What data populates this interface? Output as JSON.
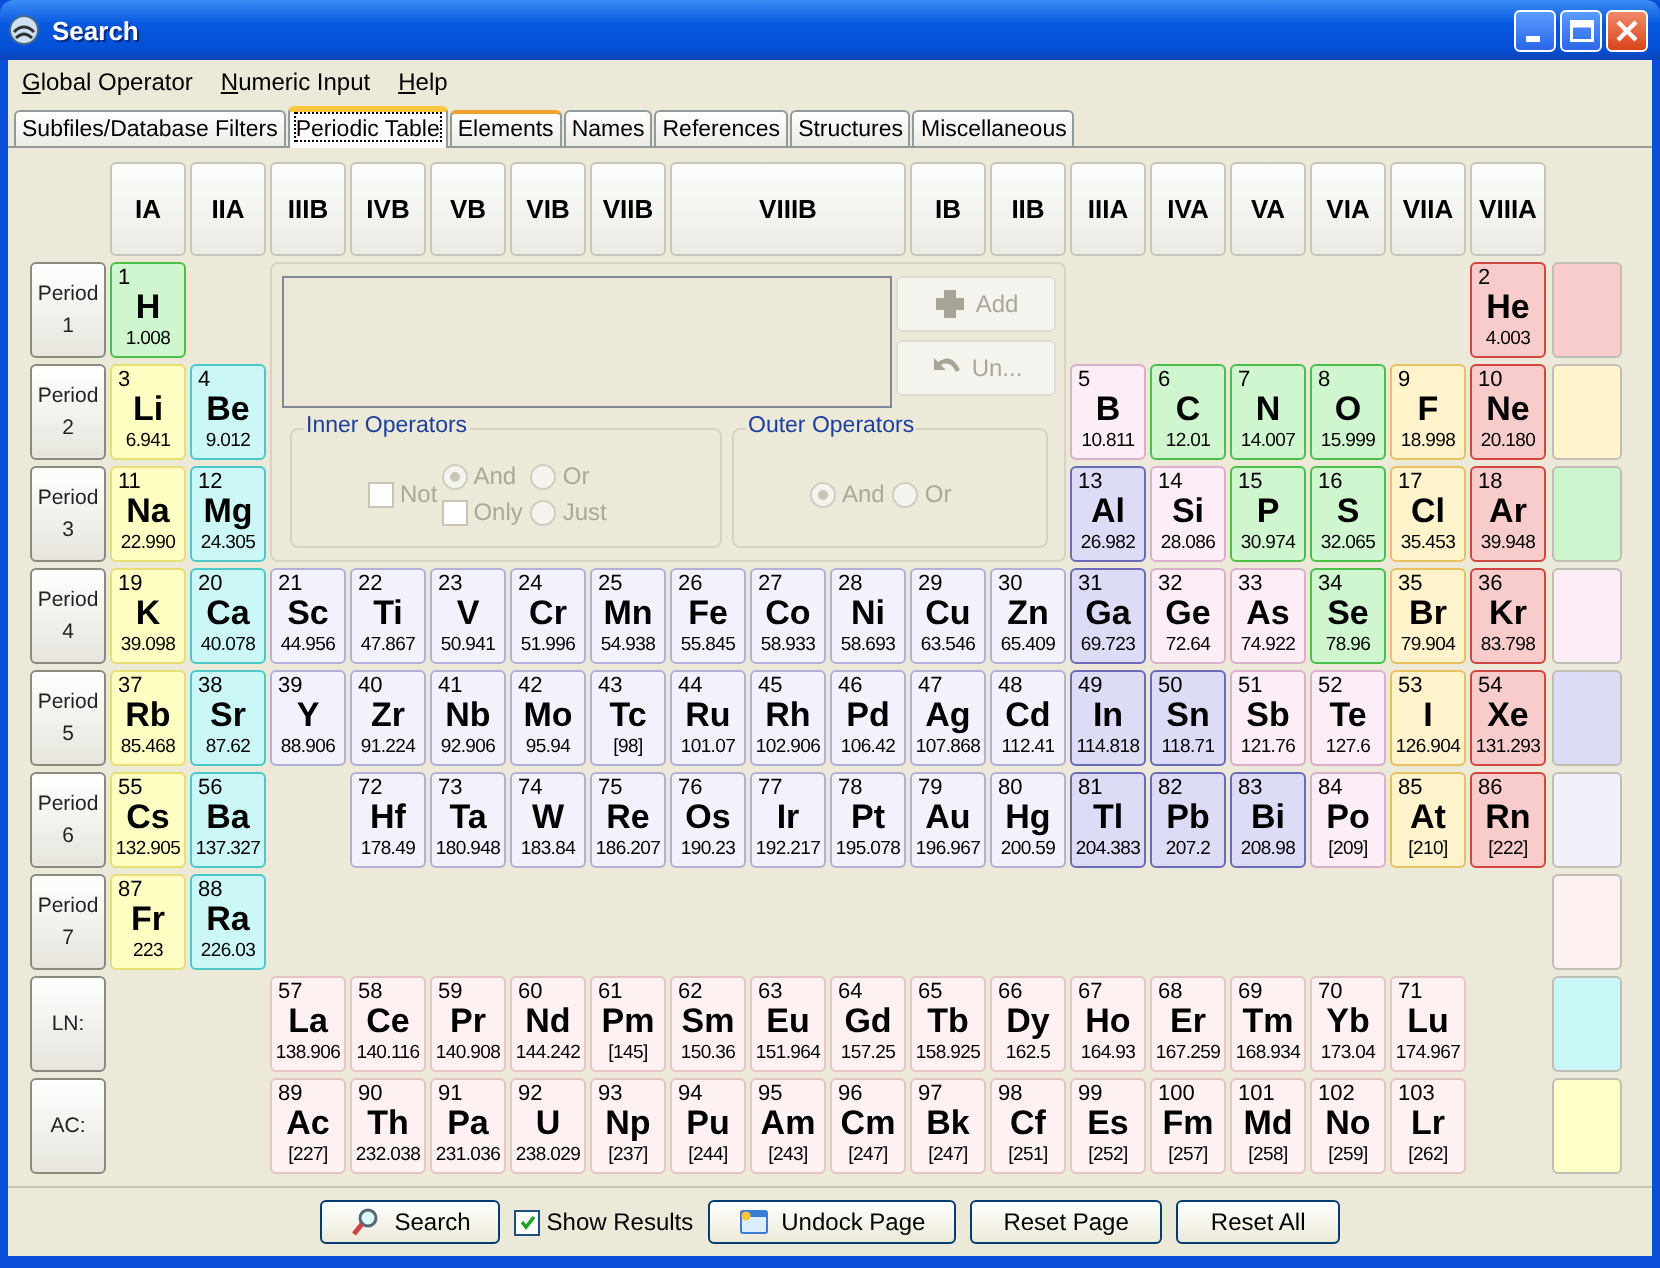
{
  "window": {
    "title": "Search"
  },
  "menu": [
    {
      "label": "Global Operator"
    },
    {
      "label": "Numeric Input"
    },
    {
      "label": "Help"
    }
  ],
  "tabs": [
    {
      "label": "Subfiles/Database Filters",
      "selected": false,
      "hot": false
    },
    {
      "label": "Periodic Table",
      "selected": true,
      "hot": false
    },
    {
      "label": "Elements",
      "selected": false,
      "hot": true
    },
    {
      "label": "Names",
      "selected": false,
      "hot": false
    },
    {
      "label": "References",
      "selected": false,
      "hot": false
    },
    {
      "label": "Structures",
      "selected": false,
      "hot": false
    },
    {
      "label": "Miscellaneous",
      "selected": false,
      "hot": false
    }
  ],
  "group_headers": [
    {
      "label": "IA",
      "wide": false
    },
    {
      "label": "IIA",
      "wide": false
    },
    {
      "label": "IIIB",
      "wide": false
    },
    {
      "label": "IVB",
      "wide": false
    },
    {
      "label": "VB",
      "wide": false
    },
    {
      "label": "VIB",
      "wide": false
    },
    {
      "label": "VIIB",
      "wide": false
    },
    {
      "label": "VIIIB",
      "wide": true
    },
    {
      "label": "IB",
      "wide": false
    },
    {
      "label": "IIB",
      "wide": false
    },
    {
      "label": "IIIA",
      "wide": false
    },
    {
      "label": "IVA",
      "wide": false
    },
    {
      "label": "VA",
      "wide": false
    },
    {
      "label": "VIA",
      "wide": false
    },
    {
      "label": "VIIA",
      "wide": false
    },
    {
      "label": "VIIIA",
      "wide": false
    }
  ],
  "periods": [
    {
      "label": "Period 1",
      "left": [
        {
          "number": "1",
          "symbol": "H",
          "mass": "1.008",
          "kind": "nonmetal"
        }
      ],
      "right": [
        {
          "number": "2",
          "symbol": "He",
          "mass": "4.003",
          "kind": "noble"
        }
      ]
    },
    {
      "label": "Period 2",
      "left": [
        {
          "number": "3",
          "symbol": "Li",
          "mass": "6.941",
          "kind": "alkali"
        },
        {
          "number": "4",
          "symbol": "Be",
          "mass": "9.012",
          "kind": "alkaline"
        }
      ],
      "right": [
        {
          "number": "5",
          "symbol": "B",
          "mass": "10.811",
          "kind": "metalloid"
        },
        {
          "number": "6",
          "symbol": "C",
          "mass": "12.01",
          "kind": "nonmetal"
        },
        {
          "number": "7",
          "symbol": "N",
          "mass": "14.007",
          "kind": "nonmetal"
        },
        {
          "number": "8",
          "symbol": "O",
          "mass": "15.999",
          "kind": "nonmetal"
        },
        {
          "number": "9",
          "symbol": "F",
          "mass": "18.998",
          "kind": "halogen"
        },
        {
          "number": "10",
          "symbol": "Ne",
          "mass": "20.180",
          "kind": "noble"
        }
      ]
    },
    {
      "label": "Period 3",
      "left": [
        {
          "number": "11",
          "symbol": "Na",
          "mass": "22.990",
          "kind": "alkali"
        },
        {
          "number": "12",
          "symbol": "Mg",
          "mass": "24.305",
          "kind": "alkaline"
        }
      ],
      "right": [
        {
          "number": "13",
          "symbol": "Al",
          "mass": "26.982",
          "kind": "post"
        },
        {
          "number": "14",
          "symbol": "Si",
          "mass": "28.086",
          "kind": "metalloid"
        },
        {
          "number": "15",
          "symbol": "P",
          "mass": "30.974",
          "kind": "nonmetal"
        },
        {
          "number": "16",
          "symbol": "S",
          "mass": "32.065",
          "kind": "nonmetal"
        },
        {
          "number": "17",
          "symbol": "Cl",
          "mass": "35.453",
          "kind": "halogen"
        },
        {
          "number": "18",
          "symbol": "Ar",
          "mass": "39.948",
          "kind": "noble"
        }
      ]
    },
    {
      "label": "Period 4",
      "left": [
        {
          "number": "19",
          "symbol": "K",
          "mass": "39.098",
          "kind": "alkali"
        },
        {
          "number": "20",
          "symbol": "Ca",
          "mass": "40.078",
          "kind": "alkaline"
        }
      ],
      "right": [
        {
          "number": "21",
          "symbol": "Sc",
          "mass": "44.956",
          "kind": "transition"
        },
        {
          "number": "22",
          "symbol": "Ti",
          "mass": "47.867",
          "kind": "transition"
        },
        {
          "number": "23",
          "symbol": "V",
          "mass": "50.941",
          "kind": "transition"
        },
        {
          "number": "24",
          "symbol": "Cr",
          "mass": "51.996",
          "kind": "transition"
        },
        {
          "number": "25",
          "symbol": "Mn",
          "mass": "54.938",
          "kind": "transition"
        },
        {
          "number": "26",
          "symbol": "Fe",
          "mass": "55.845",
          "kind": "transition"
        },
        {
          "number": "27",
          "symbol": "Co",
          "mass": "58.933",
          "kind": "transition"
        },
        {
          "number": "28",
          "symbol": "Ni",
          "mass": "58.693",
          "kind": "transition"
        },
        {
          "number": "29",
          "symbol": "Cu",
          "mass": "63.546",
          "kind": "transition"
        },
        {
          "number": "30",
          "symbol": "Zn",
          "mass": "65.409",
          "kind": "transition"
        },
        {
          "number": "31",
          "symbol": "Ga",
          "mass": "69.723",
          "kind": "post"
        },
        {
          "number": "32",
          "symbol": "Ge",
          "mass": "72.64",
          "kind": "metalloid"
        },
        {
          "number": "33",
          "symbol": "As",
          "mass": "74.922",
          "kind": "metalloid"
        },
        {
          "number": "34",
          "symbol": "Se",
          "mass": "78.96",
          "kind": "nonmetal"
        },
        {
          "number": "35",
          "symbol": "Br",
          "mass": "79.904",
          "kind": "halogen"
        },
        {
          "number": "36",
          "symbol": "Kr",
          "mass": "83.798",
          "kind": "noble"
        }
      ]
    },
    {
      "label": "Period 5",
      "left": [
        {
          "number": "37",
          "symbol": "Rb",
          "mass": "85.468",
          "kind": "alkali"
        },
        {
          "number": "38",
          "symbol": "Sr",
          "mass": "87.62",
          "kind": "alkaline"
        }
      ],
      "right": [
        {
          "number": "39",
          "symbol": "Y",
          "mass": "88.906",
          "kind": "transition"
        },
        {
          "number": "40",
          "symbol": "Zr",
          "mass": "91.224",
          "kind": "transition"
        },
        {
          "number": "41",
          "symbol": "Nb",
          "mass": "92.906",
          "kind": "transition"
        },
        {
          "number": "42",
          "symbol": "Mo",
          "mass": "95.94",
          "kind": "transition"
        },
        {
          "number": "43",
          "symbol": "Tc",
          "mass": "[98]",
          "kind": "transition"
        },
        {
          "number": "44",
          "symbol": "Ru",
          "mass": "101.07",
          "kind": "transition"
        },
        {
          "number": "45",
          "symbol": "Rh",
          "mass": "102.906",
          "kind": "transition"
        },
        {
          "number": "46",
          "symbol": "Pd",
          "mass": "106.42",
          "kind": "transition"
        },
        {
          "number": "47",
          "symbol": "Ag",
          "mass": "107.868",
          "kind": "transition"
        },
        {
          "number": "48",
          "symbol": "Cd",
          "mass": "112.41",
          "kind": "transition"
        },
        {
          "number": "49",
          "symbol": "In",
          "mass": "114.818",
          "kind": "post"
        },
        {
          "number": "50",
          "symbol": "Sn",
          "mass": "118.71",
          "kind": "post"
        },
        {
          "number": "51",
          "symbol": "Sb",
          "mass": "121.76",
          "kind": "metalloid"
        },
        {
          "number": "52",
          "symbol": "Te",
          "mass": "127.6",
          "kind": "metalloid"
        },
        {
          "number": "53",
          "symbol": "I",
          "mass": "126.904",
          "kind": "halogen"
        },
        {
          "number": "54",
          "symbol": "Xe",
          "mass": "131.293",
          "kind": "noble"
        }
      ]
    },
    {
      "label": "Period 6",
      "left": [
        {
          "number": "55",
          "symbol": "Cs",
          "mass": "132.905",
          "kind": "alkali"
        },
        {
          "number": "56",
          "symbol": "Ba",
          "mass": "137.327",
          "kind": "alkaline"
        }
      ],
      "right": [
        {
          "number": "72",
          "symbol": "Hf",
          "mass": "178.49",
          "kind": "transition"
        },
        {
          "number": "73",
          "symbol": "Ta",
          "mass": "180.948",
          "kind": "transition"
        },
        {
          "number": "74",
          "symbol": "W",
          "mass": "183.84",
          "kind": "transition"
        },
        {
          "number": "75",
          "symbol": "Re",
          "mass": "186.207",
          "kind": "transition"
        },
        {
          "number": "76",
          "symbol": "Os",
          "mass": "190.23",
          "kind": "transition"
        },
        {
          "number": "77",
          "symbol": "Ir",
          "mass": "192.217",
          "kind": "transition"
        },
        {
          "number": "78",
          "symbol": "Pt",
          "mass": "195.078",
          "kind": "transition"
        },
        {
          "number": "79",
          "symbol": "Au",
          "mass": "196.967",
          "kind": "transition"
        },
        {
          "number": "80",
          "symbol": "Hg",
          "mass": "200.59",
          "kind": "transition"
        },
        {
          "number": "81",
          "symbol": "Tl",
          "mass": "204.383",
          "kind": "post"
        },
        {
          "number": "82",
          "symbol": "Pb",
          "mass": "207.2",
          "kind": "post"
        },
        {
          "number": "83",
          "symbol": "Bi",
          "mass": "208.98",
          "kind": "post"
        },
        {
          "number": "84",
          "symbol": "Po",
          "mass": "[209]",
          "kind": "metalloid"
        },
        {
          "number": "85",
          "symbol": "At",
          "mass": "[210]",
          "kind": "halogen"
        },
        {
          "number": "86",
          "symbol": "Rn",
          "mass": "[222]",
          "kind": "noble"
        }
      ]
    },
    {
      "label": "Period 7",
      "left": [
        {
          "number": "87",
          "symbol": "Fr",
          "mass": "223",
          "kind": "alkali"
        },
        {
          "number": "88",
          "symbol": "Ra",
          "mass": "226.03",
          "kind": "alkaline"
        }
      ]
    }
  ],
  "series": [
    {
      "label": "LN:",
      "elements": [
        {
          "number": "57",
          "symbol": "La",
          "mass": "138.906"
        },
        {
          "number": "58",
          "symbol": "Ce",
          "mass": "140.116"
        },
        {
          "number": "59",
          "symbol": "Pr",
          "mass": "140.908"
        },
        {
          "number": "60",
          "symbol": "Nd",
          "mass": "144.242"
        },
        {
          "number": "61",
          "symbol": "Pm",
          "mass": "[145]"
        },
        {
          "number": "62",
          "symbol": "Sm",
          "mass": "150.36"
        },
        {
          "number": "63",
          "symbol": "Eu",
          "mass": "151.964"
        },
        {
          "number": "64",
          "symbol": "Gd",
          "mass": "157.25"
        },
        {
          "number": "65",
          "symbol": "Tb",
          "mass": "158.925"
        },
        {
          "number": "66",
          "symbol": "Dy",
          "mass": "162.5"
        },
        {
          "number": "67",
          "symbol": "Ho",
          "mass": "164.93"
        },
        {
          "number": "68",
          "symbol": "Er",
          "mass": "167.259"
        },
        {
          "number": "69",
          "symbol": "Tm",
          "mass": "168.934"
        },
        {
          "number": "70",
          "symbol": "Yb",
          "mass": "173.04"
        },
        {
          "number": "71",
          "symbol": "Lu",
          "mass": "174.967"
        }
      ]
    },
    {
      "label": "AC:",
      "elements": [
        {
          "number": "89",
          "symbol": "Ac",
          "mass": "[227]"
        },
        {
          "number": "90",
          "symbol": "Th",
          "mass": "232.038"
        },
        {
          "number": "91",
          "symbol": "Pa",
          "mass": "231.036"
        },
        {
          "number": "92",
          "symbol": "U",
          "mass": "238.029"
        },
        {
          "number": "93",
          "symbol": "Np",
          "mass": "[237]"
        },
        {
          "number": "94",
          "symbol": "Pu",
          "mass": "[244]"
        },
        {
          "number": "95",
          "symbol": "Am",
          "mass": "[243]"
        },
        {
          "number": "96",
          "symbol": "Cm",
          "mass": "[247]"
        },
        {
          "number": "97",
          "symbol": "Bk",
          "mass": "[247]"
        },
        {
          "number": "98",
          "symbol": "Cf",
          "mass": "[251]"
        },
        {
          "number": "99",
          "symbol": "Es",
          "mass": "[252]"
        },
        {
          "number": "100",
          "symbol": "Fm",
          "mass": "[257]"
        },
        {
          "number": "101",
          "symbol": "Md",
          "mass": "[258]"
        },
        {
          "number": "102",
          "symbol": "No",
          "mass": "[259]"
        },
        {
          "number": "103",
          "symbol": "Lr",
          "mass": "[262]"
        }
      ]
    }
  ],
  "legend": [
    {
      "color": "#f9cccc"
    },
    {
      "color": "#fff3cc"
    },
    {
      "color": "#cdf5cd"
    },
    {
      "color": "#fcecf6"
    },
    {
      "color": "#dcdcf6"
    },
    {
      "color": "#f0f0fb"
    },
    {
      "color": "#fcf0f0"
    },
    {
      "color": "#c9f6f6"
    },
    {
      "color": "#ffffc8"
    }
  ],
  "operators": {
    "disabled": true,
    "add_button": "Add",
    "undo_button": "Un...",
    "inner": {
      "title": "Inner Operators",
      "not": {
        "label": "Not",
        "checked": false
      },
      "options": [
        {
          "kind": "radio",
          "label": "And",
          "selected": true
        },
        {
          "kind": "radio",
          "label": "Or",
          "selected": false
        },
        {
          "kind": "checkbox",
          "label": "Only",
          "checked": false
        },
        {
          "kind": "radio",
          "label": "Just",
          "selected": false
        }
      ]
    },
    "outer": {
      "title": "Outer Operators",
      "options": [
        {
          "kind": "radio",
          "label": "And",
          "selected": true
        },
        {
          "kind": "radio",
          "label": "Or",
          "selected": false
        }
      ]
    }
  },
  "bottom": {
    "search_button": "Search",
    "show_results": {
      "label": "Show Results",
      "checked": true
    },
    "undock_button": "Undock Page",
    "reset_page_button": "Reset Page",
    "reset_all_button": "Reset All"
  }
}
